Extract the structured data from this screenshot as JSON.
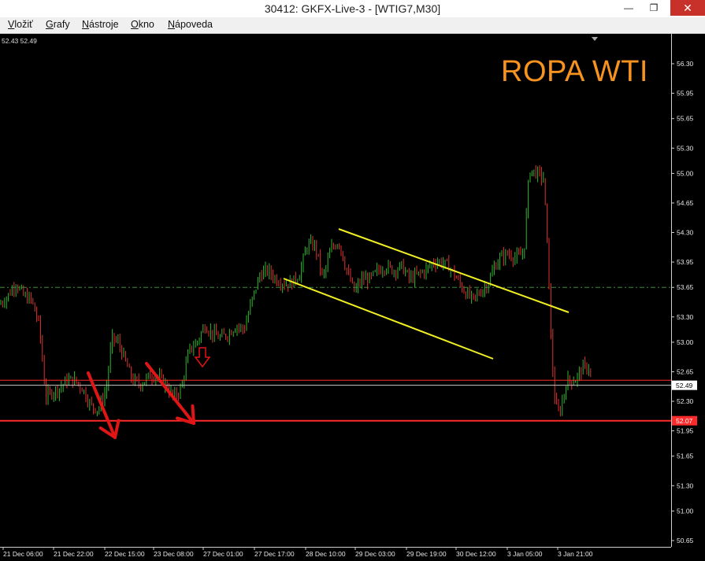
{
  "window": {
    "title": "30412: GKFX-Live-3 - [WTIG7,M30]",
    "min_glyph": "—",
    "max_glyph": "❐",
    "close_glyph": "✕"
  },
  "menu": [
    {
      "first": "V",
      "rest": "ložiť"
    },
    {
      "first": "G",
      "rest": "rafy"
    },
    {
      "first": "N",
      "rest": "ástroje"
    },
    {
      "first": "O",
      "rest": "kno"
    },
    {
      "first": "N",
      "rest": "ápoveda"
    }
  ],
  "mdi": {
    "min": "_",
    "restore": "❐",
    "close": "✕"
  },
  "chart": {
    "header_prices": "52.43 52.49",
    "overlay_title": "ROPA WTI",
    "y_ticks": [
      "56.30",
      "55.95",
      "55.65",
      "55.30",
      "55.00",
      "54.65",
      "54.30",
      "53.95",
      "53.65",
      "53.30",
      "53.00",
      "52.65",
      "52.30",
      "51.95",
      "51.65",
      "51.30",
      "51.00",
      "50.65"
    ],
    "x_ticks": [
      "21 Dec 06:00",
      "21 Dec 22:00",
      "22 Dec 15:00",
      "23 Dec 08:00",
      "27 Dec 01:00",
      "27 Dec 17:00",
      "28 Dec 10:00",
      "29 Dec 03:00",
      "29 Dec 19:00",
      "30 Dec 12:00",
      "3 Jan 05:00",
      "3 Jan 21:00"
    ],
    "current_price_label": "52.49",
    "support_label": "52.07",
    "colors": {
      "bull": "#2db82d",
      "bear": "#e03030",
      "channel": "#f0f022",
      "arrows": "#e01515",
      "support": "#ff2a2a",
      "dashed_level": "#3c8c3c",
      "title": "#f7931e"
    }
  },
  "chart_data": {
    "type": "candlestick",
    "symbol": "WTIG7",
    "timeframe": "M30",
    "ylim": [
      50.6,
      56.5
    ],
    "close_path": [
      [
        0,
        53.45
      ],
      [
        10,
        53.55
      ],
      [
        20,
        53.7
      ],
      [
        30,
        53.55
      ],
      [
        40,
        53.5
      ],
      [
        50,
        53.2
      ],
      [
        58,
        52.35
      ],
      [
        65,
        52.4
      ],
      [
        75,
        52.45
      ],
      [
        85,
        52.55
      ],
      [
        95,
        52.55
      ],
      [
        105,
        52.45
      ],
      [
        115,
        52.25
      ],
      [
        125,
        52.2
      ],
      [
        135,
        52.45
      ],
      [
        142,
        53.05
      ],
      [
        150,
        53.0
      ],
      [
        160,
        52.75
      ],
      [
        168,
        52.55
      ],
      [
        178,
        52.5
      ],
      [
        190,
        52.6
      ],
      [
        200,
        52.6
      ],
      [
        210,
        52.5
      ],
      [
        220,
        52.35
      ],
      [
        230,
        52.45
      ],
      [
        240,
        52.9
      ],
      [
        250,
        53.0
      ],
      [
        260,
        53.2
      ],
      [
        270,
        53.1
      ],
      [
        280,
        53.05
      ],
      [
        290,
        53.1
      ],
      [
        300,
        53.2
      ],
      [
        310,
        53.15
      ],
      [
        320,
        53.5
      ],
      [
        330,
        53.8
      ],
      [
        340,
        53.85
      ],
      [
        350,
        53.75
      ],
      [
        360,
        53.7
      ],
      [
        370,
        53.7
      ],
      [
        380,
        53.8
      ],
      [
        390,
        54.15
      ],
      [
        400,
        54.15
      ],
      [
        410,
        53.75
      ],
      [
        420,
        54.1
      ],
      [
        430,
        54.2
      ],
      [
        440,
        53.85
      ],
      [
        450,
        53.6
      ],
      [
        460,
        53.75
      ],
      [
        470,
        53.75
      ],
      [
        480,
        53.85
      ],
      [
        490,
        53.9
      ],
      [
        500,
        53.85
      ],
      [
        510,
        53.9
      ],
      [
        520,
        53.75
      ],
      [
        530,
        53.8
      ],
      [
        540,
        53.85
      ],
      [
        550,
        53.95
      ],
      [
        560,
        53.95
      ],
      [
        570,
        53.9
      ],
      [
        580,
        53.75
      ],
      [
        590,
        53.6
      ],
      [
        600,
        53.5
      ],
      [
        610,
        53.6
      ],
      [
        620,
        53.7
      ],
      [
        628,
        53.9
      ],
      [
        635,
        54.0
      ],
      [
        645,
        54.05
      ],
      [
        655,
        54.0
      ],
      [
        665,
        54.05
      ],
      [
        672,
        55.05
      ],
      [
        682,
        55.0
      ],
      [
        690,
        54.95
      ],
      [
        696,
        53.95
      ],
      [
        700,
        52.9
      ],
      [
        705,
        52.25
      ],
      [
        710,
        52.15
      ],
      [
        720,
        52.55
      ],
      [
        730,
        52.55
      ],
      [
        740,
        52.7
      ],
      [
        748,
        52.7
      ],
      [
        752,
        52.55
      ]
    ],
    "levels": {
      "current_price": 52.49,
      "support": 52.07,
      "upper_red": 52.55,
      "dashed_green": 53.65
    }
  }
}
